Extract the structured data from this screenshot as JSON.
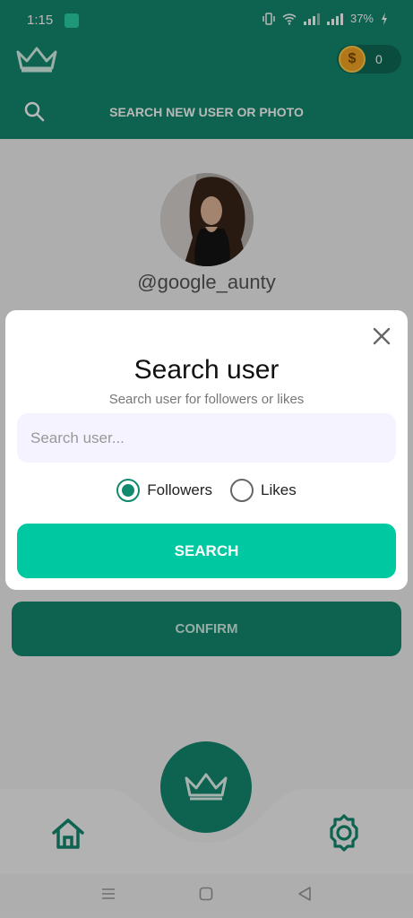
{
  "status_bar": {
    "time": "1:15",
    "battery": "37%",
    "icons": [
      "app-notification-icon",
      "vibrate-icon",
      "wifi-icon",
      "signal-icon",
      "battery-charging-icon"
    ]
  },
  "header": {
    "logo_icon": "crown-icon",
    "coins": "0",
    "coin_symbol": "$",
    "search_prompt": "SEARCH NEW USER OR PHOTO"
  },
  "profile": {
    "username": "@google_aunty"
  },
  "confirm_label": "CONFIRM",
  "bottom_nav": {
    "items": [
      "home-icon",
      "crown-icon",
      "settings-icon"
    ]
  },
  "system_nav": [
    "menu-icon",
    "home-square-icon",
    "back-triangle-icon"
  ],
  "dialog": {
    "title": "Search user",
    "subtitle": "Search user for followers or likes",
    "input_placeholder": "Search user...",
    "input_value": "",
    "options": [
      {
        "label": "Followers",
        "selected": true
      },
      {
        "label": "Likes",
        "selected": false
      }
    ],
    "search_label": "SEARCH"
  },
  "colors": {
    "primary": "#128a70",
    "accent": "#00c9a1",
    "input_bg": "#f4f3ff",
    "coin": "#f5a623"
  }
}
